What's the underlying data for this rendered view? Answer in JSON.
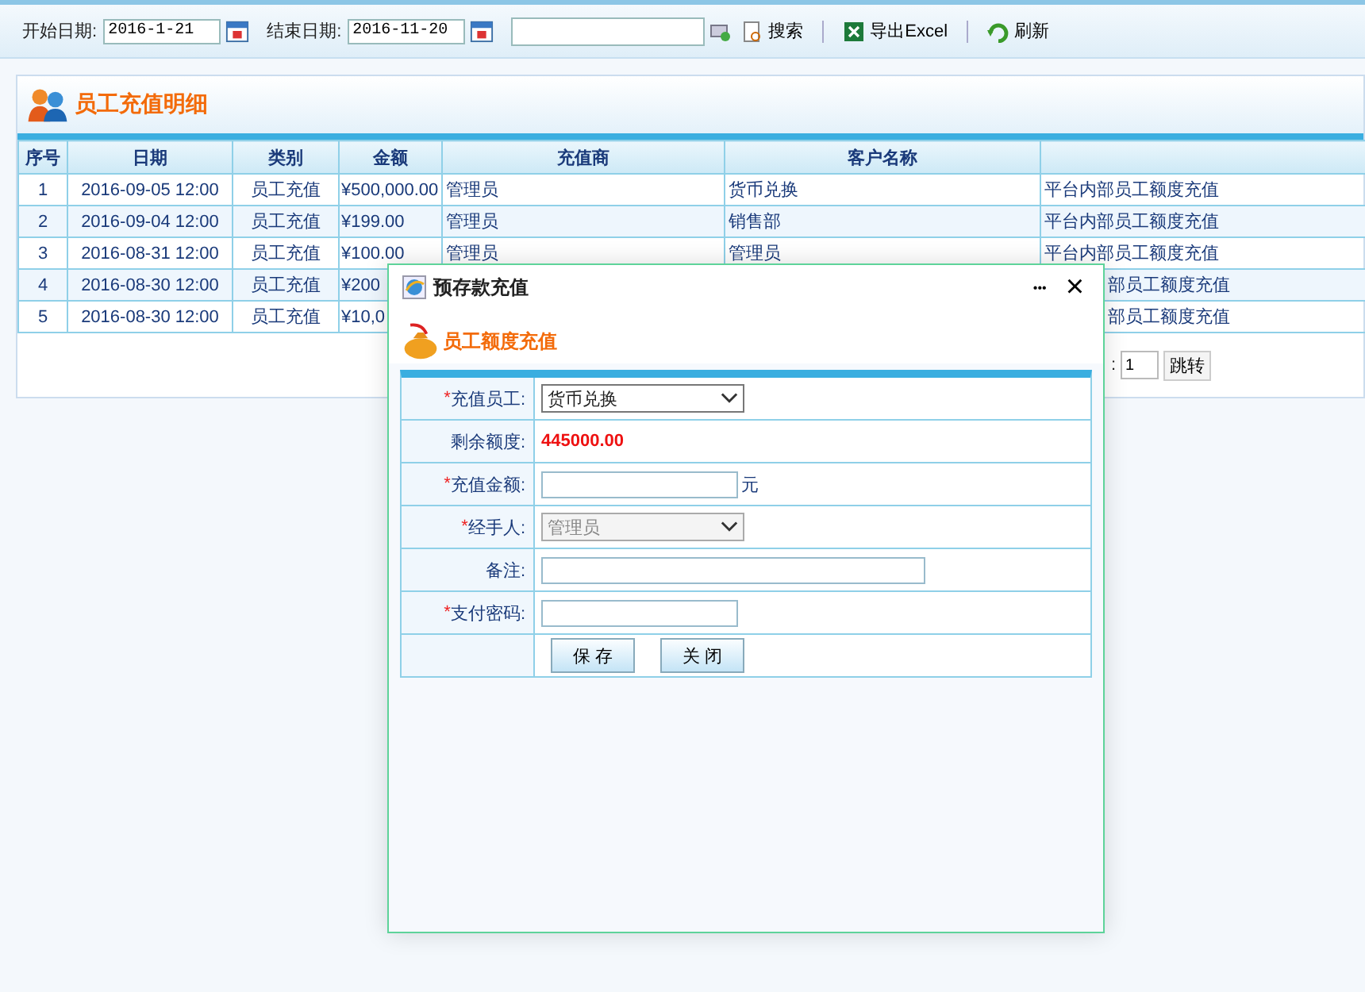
{
  "toolbar": {
    "start_label": "开始日期:",
    "start_value": "2016-1-21",
    "end_label": "结束日期:",
    "end_value": "2016-11-20",
    "search_button": "搜索",
    "export_button": "导出Excel",
    "refresh_button": "刷新"
  },
  "panel": {
    "title": "员工充值明细"
  },
  "table": {
    "columns": [
      "序号",
      "日期",
      "类别",
      "金额",
      "充值商",
      "客户名称"
    ],
    "rows": [
      {
        "cells": [
          "1",
          "2016-09-05 12:00",
          "员工充值",
          "¥500,000.00",
          "管理员",
          "货币兑换",
          "平台内部员工额度充值"
        ],
        "under_dialog": false
      },
      {
        "cells": [
          "2",
          "2016-09-04 12:00",
          "员工充值",
          "¥199.00",
          "管理员",
          "销售部",
          "平台内部员工额度充值"
        ],
        "under_dialog": false
      },
      {
        "cells": [
          "3",
          "2016-08-31 12:00",
          "员工充值",
          "¥100.00",
          "管理员",
          "管理员",
          "平台内部员工额度充值"
        ],
        "under_dialog": false
      },
      {
        "cells": [
          "4",
          "2016-08-30 12:00",
          "员工充值",
          "¥200",
          "",
          "",
          "部员工额度充值"
        ],
        "under_dialog": true
      },
      {
        "cells": [
          "5",
          "2016-08-30 12:00",
          "员工充值",
          "¥10,0",
          "",
          "",
          "部员工额度充值"
        ],
        "under_dialog": true
      }
    ]
  },
  "pager": {
    "label": ":",
    "page_value": "1",
    "go_button": "跳转"
  },
  "dialog": {
    "title": "预存款充值",
    "more": "•••",
    "close": "×",
    "subtitle": "员工额度充值",
    "fields": [
      {
        "kind": "select",
        "required_mark": "*",
        "label": "充值员工:",
        "value": "货币兑换",
        "disabled": false
      },
      {
        "kind": "static",
        "label": "剩余额度:",
        "value": "445000.00"
      },
      {
        "kind": "input",
        "required_mark": "*",
        "label": "充值金额:",
        "unit": "元"
      },
      {
        "kind": "select",
        "required_mark": "*",
        "label": "经手人:",
        "value": "管理员",
        "disabled": true
      },
      {
        "kind": "wide",
        "label": "备注:"
      },
      {
        "kind": "input",
        "required_mark": "*",
        "label": "支付密码:"
      }
    ],
    "buttons": [
      "保 存",
      "关 闭"
    ]
  }
}
